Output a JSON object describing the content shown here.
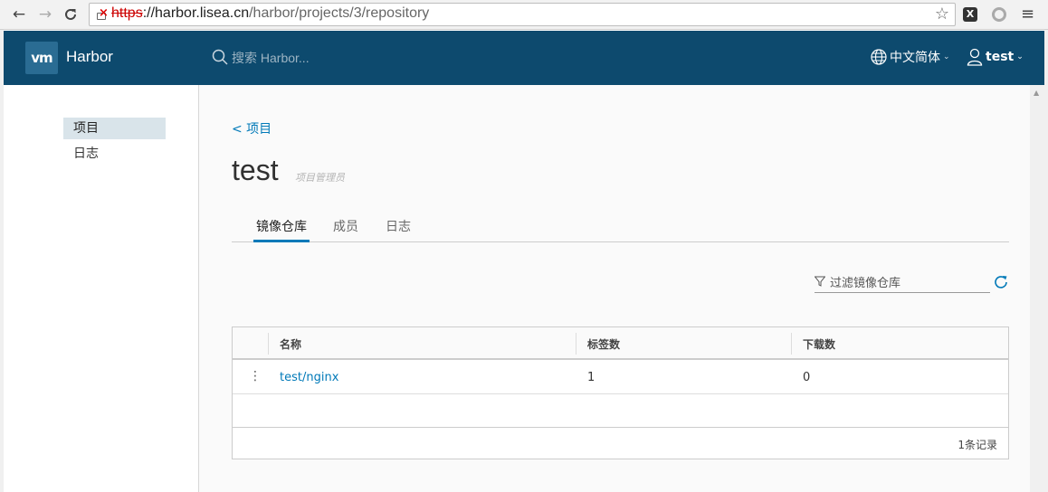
{
  "browser": {
    "url_scheme": "https",
    "url_host": "://harbor.lisea.cn",
    "url_path": "/harbor/projects/3/repository"
  },
  "header": {
    "logo_text": "vm",
    "brand": "Harbor",
    "search_placeholder": "搜索 Harbor...",
    "language": "中文简体",
    "user": "test"
  },
  "sidebar": {
    "items": [
      {
        "label": "项目"
      },
      {
        "label": "日志"
      }
    ]
  },
  "main": {
    "breadcrumb": "< 项目",
    "title": "test",
    "role": "项目管理员",
    "tabs": [
      {
        "label": "镜像仓库"
      },
      {
        "label": "成员"
      },
      {
        "label": "日志"
      }
    ],
    "filter_placeholder": "过滤镜像仓库"
  },
  "grid": {
    "columns": [
      "名称",
      "标签数",
      "下载数"
    ],
    "rows": [
      {
        "name": "test/nginx",
        "tags": "1",
        "pulls": "0"
      }
    ],
    "footer": "1条记录"
  },
  "colors": {
    "header_bg": "#0d4a6e",
    "accent": "#0079b8"
  }
}
